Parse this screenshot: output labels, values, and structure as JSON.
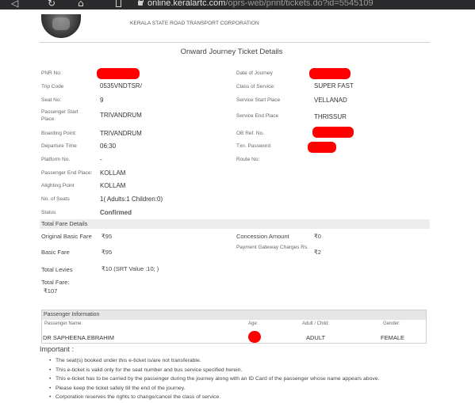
{
  "browser": {
    "url_host": "online.keralartc.com",
    "url_path": "/oprs-web/print/tickets.do?id=5545109"
  },
  "header": {
    "corporation": "KERALA STATE ROAD TRANSPORT CORPORATION",
    "title": "Onward Journey Ticket Details"
  },
  "details": {
    "pnr_label": "PNR No:",
    "date_label": "Date of Journey",
    "trip_code_label": "Trip Code",
    "trip_code": "0535VNDTSR/",
    "class_label": "Class of Service:",
    "class": "SUPER FAST",
    "seat_label": "Seat No:",
    "seat": "9",
    "svc_start_label": "Service Start Place",
    "svc_start": "VELLANAD",
    "pax_start_label": "Passenger Start Place:",
    "pax_start": "TRIVANDRUM",
    "svc_end_label": "Service End Place",
    "svc_end": "THRISSUR",
    "boarding_label": "Boarding Point:",
    "boarding": "TRIVANDRUM",
    "ob_ref_label": "OB Ref. No.",
    "departure_label": "Departure Time",
    "departure": "06:30",
    "txn_label": "Txn. Password",
    "platform_label": "Platform No.",
    "platform": "-",
    "route_label": "Route No:",
    "pax_end_label": "Passenger End Place:",
    "pax_end": "KOLLAM",
    "alighting_label": "Alighting Point",
    "alighting": "KOLLAM",
    "seats_label": "No. of Seats",
    "seats": "1( Adults:1  Children:0)",
    "status_label": "Status",
    "status": "Confirmed"
  },
  "fare": {
    "section": "Total Fare Details",
    "original_label": "Original Basic Fare",
    "original": "₹95",
    "concession_label": "Concession Amount",
    "concession": "₹0",
    "basic_label": "Basic Fare",
    "basic": "₹95",
    "gateway_label": "Payment Gateway Charges Rs.",
    "gateway": "₹2",
    "levies_label": "Total Levies",
    "levies": "₹10  (SRT Value :10; )",
    "total_label": "Total Fare:",
    "total": "₹107"
  },
  "passenger": {
    "section": "Passenger Information",
    "name_col": "Passenger Name:",
    "age_col": "Age:",
    "type_col": "Adult / Child:",
    "gender_col": "Gender:",
    "name": "DR SAPHEENA.EBRAHIM",
    "type": "ADULT",
    "gender": "FEMALE"
  },
  "important": {
    "heading": "Important :",
    "notes": [
      "The seat(s) booked under this e-ticket is/are not transferable.",
      "This e-ticket is valid only for the seat number and bus service specified herein.",
      "This e-ticket has to be carried by the passenger during the journey along with an ID Card of the passenger whose name appears above.",
      "Please keep the ticket safely till the end of the journey.",
      "Corporation reserves the rights to change/cancel the class of service."
    ]
  },
  "colors": {
    "redaction": "#ff0000",
    "section_bg": "#ececec"
  }
}
